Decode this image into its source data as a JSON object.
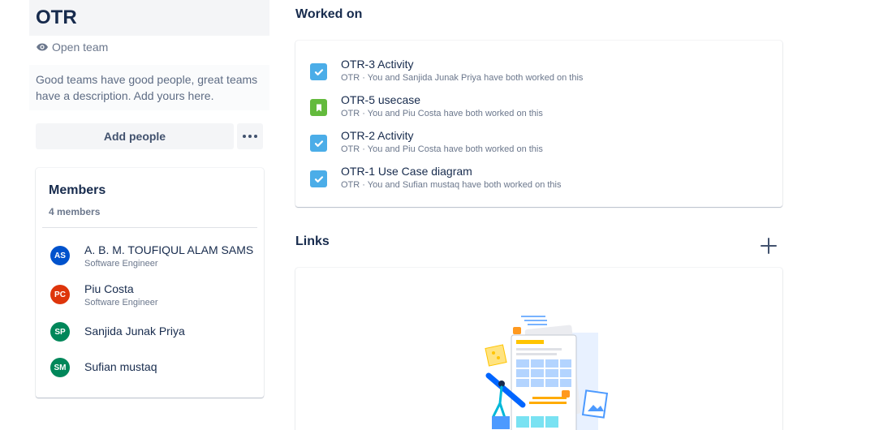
{
  "team": {
    "name": "OTR",
    "visibility": "Open team",
    "description": "Good teams have good people, great teams have a description. Add yours here.",
    "add_people_label": "Add people"
  },
  "members": {
    "title": "Members",
    "count_label": "4 members",
    "items": [
      {
        "initials": "AS",
        "name": "A. B. M. TOUFIQUL ALAM SAMS",
        "role": "Software Engineer",
        "color": "#0052cc"
      },
      {
        "initials": "PC",
        "name": "Piu Costa",
        "role": "Software Engineer",
        "color": "#de350b"
      },
      {
        "initials": "SP",
        "name": "Sanjida Junak Priya",
        "role": "",
        "color": "#00875a"
      },
      {
        "initials": "SM",
        "name": "Sufian mustaq",
        "role": "",
        "color": "#00875a"
      }
    ]
  },
  "worked_on": {
    "title": "Worked on",
    "items": [
      {
        "icon": "task-checkbox-icon",
        "title": "OTR-3 Activity",
        "meta": "OTR · You and Sanjida Junak Priya have both worked on this",
        "color": "#4bade8"
      },
      {
        "icon": "story-bookmark-icon",
        "title": "OTR-5 usecase",
        "meta": "OTR · You and Piu Costa have both worked on this",
        "color": "#63ba3c"
      },
      {
        "icon": "task-checkbox-icon",
        "title": "OTR-2 Activity",
        "meta": "OTR · You and Piu Costa have both worked on this",
        "color": "#4bade8"
      },
      {
        "icon": "task-checkbox-icon",
        "title": "OTR-1 Use Case diagram",
        "meta": "OTR · You and Sufian mustaq have both worked on this",
        "color": "#4bade8"
      }
    ]
  },
  "links": {
    "title": "Links",
    "add_icon": "plus-icon"
  }
}
